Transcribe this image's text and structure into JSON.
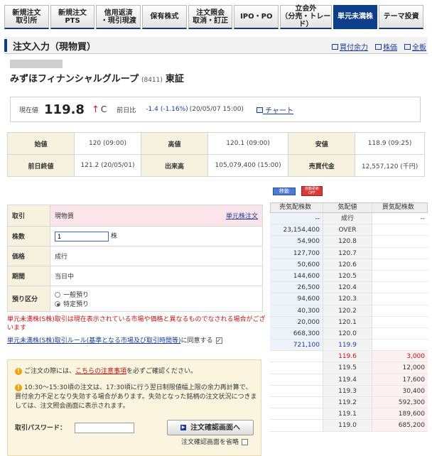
{
  "tabs": [
    {
      "label": "新規注文\n取引所",
      "active": false
    },
    {
      "label": "新規注文\nPTS",
      "active": false
    },
    {
      "label": "信用返済\n・現引現渡",
      "active": false
    },
    {
      "label": "保有株式",
      "active": false
    },
    {
      "label": "注文照会\n取消・訂正",
      "active": false
    },
    {
      "label": "IPO・PO",
      "active": false
    },
    {
      "label": "立会外\n（分売・トレード）",
      "active": false
    },
    {
      "label": "単元未満株",
      "active": true
    },
    {
      "label": "テーマ投資",
      "active": false
    }
  ],
  "page_title": "注文入力（現物買）",
  "title_links": [
    "買付余力",
    "株価",
    "全板"
  ],
  "stock": {
    "name": "みずほフィナンシャルグループ",
    "code": "(8411)",
    "market": "東証"
  },
  "price": {
    "label": "現在値",
    "value": "119.8",
    "arrow": "↑",
    "flag": "C",
    "change_label": "前日比",
    "change": "-1.4",
    "change_pct": "(-1.16%)",
    "time": "(20/05/07 15:00)",
    "chart_link": "チャート"
  },
  "summary": [
    [
      {
        "h": "始値"
      },
      {
        "v": "120 (09:00)"
      },
      {
        "h": "高値"
      },
      {
        "v": "120.1 (09:00)"
      },
      {
        "h": "安値"
      },
      {
        "v": "118.9 (09:25)"
      }
    ],
    [
      {
        "h": "前日終値"
      },
      {
        "v": "121.2 (20/05/01)"
      },
      {
        "h": "出来高"
      },
      {
        "v": "105,079,400 (15:00)"
      },
      {
        "h": "売買代金"
      },
      {
        "v": "12,557,120 (千円)"
      }
    ]
  ],
  "buttons": {
    "move": "移動",
    "auto": "自動更新 OFF"
  },
  "order": {
    "trade_label": "取引",
    "trade_value": "現物買",
    "trade_link": "単元株注文",
    "qty_label": "株数",
    "qty_value": "1",
    "qty_unit": "株",
    "price_label": "価格",
    "price_value": "成行",
    "period_label": "期間",
    "period_value": "当日中",
    "deposit_label": "預り区分",
    "deposit_options": [
      "一般預り",
      "特定預り"
    ],
    "deposit_selected": 1
  },
  "warning_text": "単元未満株(S株)取引は現在表示されている市場や価格と異なるものでなされる場合がございます",
  "rule_link": "単元未満株(S株)取引ルール(基準となる市場及び取引時間等)",
  "rule_agree": "に同意する",
  "notice": {
    "line1_prefix": "ご注文の際には、",
    "line1_link": "こちらの注意事項",
    "line1_suffix": "を必ずご確認ください。",
    "line2": "10:30～15:30頃の注文は、17:30頃に行う翌日制限値幅上限の余力再計算で、買付余力不足となり失効する場合があります。失効となった銘柄の注文状況につきましては、注文照会画面に表示されます。",
    "pw_label": "取引パスワード：",
    "confirm_button": "注文確認画面へ",
    "skip_label": "注文確認画面を省略"
  },
  "book": {
    "headers": [
      "売気配株数",
      "気配値",
      "買気配株数"
    ],
    "rows": [
      {
        "ask": "--",
        "price": "成行",
        "bid": "--",
        "type": "ask"
      },
      {
        "ask": "23,154,400",
        "price": "OVER",
        "bid": "",
        "type": "ask"
      },
      {
        "ask": "54,900",
        "price": "120.8",
        "bid": "",
        "type": "ask"
      },
      {
        "ask": "127,700",
        "price": "120.7",
        "bid": "",
        "type": "ask"
      },
      {
        "ask": "50,600",
        "price": "120.6",
        "bid": "",
        "type": "ask"
      },
      {
        "ask": "144,600",
        "price": "120.5",
        "bid": "",
        "type": "ask"
      },
      {
        "ask": "26,500",
        "price": "120.4",
        "bid": "",
        "type": "ask"
      },
      {
        "ask": "94,600",
        "price": "120.3",
        "bid": "",
        "type": "ask"
      },
      {
        "ask": "40,300",
        "price": "120.2",
        "bid": "",
        "type": "ask"
      },
      {
        "ask": "20,000",
        "price": "120.1",
        "bid": "",
        "type": "ask"
      },
      {
        "ask": "668,300",
        "price": "120.0",
        "bid": "",
        "type": "ask"
      },
      {
        "ask": "721,100",
        "price": "119.9",
        "bid": "",
        "type": "ask cur"
      },
      {
        "ask": "",
        "price": "119.6",
        "bid": "3,000",
        "type": "bid curb"
      },
      {
        "ask": "",
        "price": "119.5",
        "bid": "12,000",
        "type": "bid"
      },
      {
        "ask": "",
        "price": "119.4",
        "bid": "17,600",
        "type": "bid"
      },
      {
        "ask": "",
        "price": "119.3",
        "bid": "30,400",
        "type": "bid"
      },
      {
        "ask": "",
        "price": "119.2",
        "bid": "592,300",
        "type": "bid"
      },
      {
        "ask": "",
        "price": "119.1",
        "bid": "189,600",
        "type": "bid"
      },
      {
        "ask": "",
        "price": "119.0",
        "bid": "685,200",
        "type": "bid"
      }
    ]
  }
}
